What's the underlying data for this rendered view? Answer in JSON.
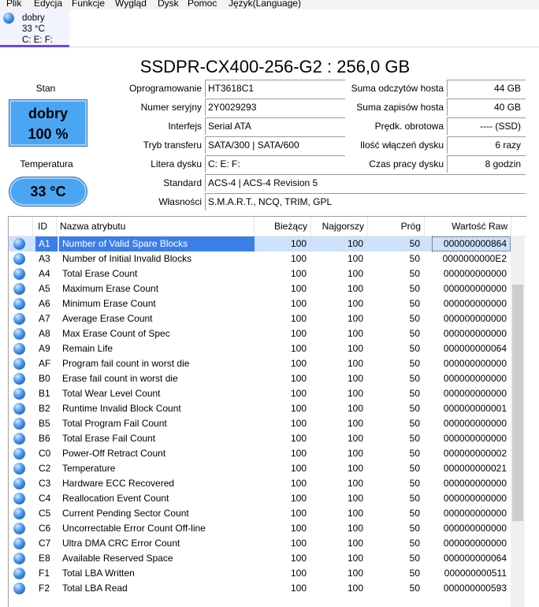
{
  "menu": [
    "Plik",
    "Edycja",
    "Funkcje",
    "Wygląd",
    "Dysk",
    "Pomoc",
    "Język(Language)"
  ],
  "disk_tab": {
    "status": "dobry",
    "temp": "33 °C",
    "letters": "C: E: F:"
  },
  "title": "SSDPR-CX400-256-G2 : 256,0 GB",
  "status": {
    "health_caption": "Stan",
    "health_label": "dobry",
    "health_percent": "100 %",
    "temp_caption": "Temperatura",
    "temp_value": "33 °C"
  },
  "info_left": [
    {
      "label": "Oprogramowanie",
      "value": "HT3618C1"
    },
    {
      "label": "Numer seryjny",
      "value": "2Y0029293"
    },
    {
      "label": "Interfejs",
      "value": "Serial ATA"
    },
    {
      "label": "Tryb transferu",
      "value": "SATA/300 | SATA/600"
    },
    {
      "label": "Litera dysku",
      "value": "C: E: F:"
    }
  ],
  "info_right": [
    {
      "label": "Suma odczytów hosta",
      "value": "44 GB"
    },
    {
      "label": "Suma zapisów hosta",
      "value": "40 GB"
    },
    {
      "label": "Prędk. obrotowa",
      "value": "---- (SSD)"
    },
    {
      "label": "Ilość włączeń dysku",
      "value": "6 razy"
    },
    {
      "label": "Czas pracy dysku",
      "value": "8 godzin"
    }
  ],
  "info_wide": [
    {
      "label": "Standard",
      "value": "ACS-4 | ACS-4 Revision 5"
    },
    {
      "label": "Własności",
      "value": "S.M.A.R.T., NCQ, TRIM, GPL"
    }
  ],
  "table": {
    "columns": [
      "ID",
      "Nazwa atrybutu",
      "Bieżący",
      "Najgorszy",
      "Próg",
      "Wartość Raw"
    ],
    "rows": [
      [
        "A1",
        "Number of Valid Spare Blocks",
        "100",
        "100",
        "50",
        "000000000864"
      ],
      [
        "A3",
        "Number of Initial Invalid Blocks",
        "100",
        "100",
        "50",
        "0000000000E2"
      ],
      [
        "A4",
        "Total Erase Count",
        "100",
        "100",
        "50",
        "000000000000"
      ],
      [
        "A5",
        "Maximum Erase Count",
        "100",
        "100",
        "50",
        "000000000000"
      ],
      [
        "A6",
        "Minimum Erase Count",
        "100",
        "100",
        "50",
        "000000000000"
      ],
      [
        "A7",
        "Average Erase Count",
        "100",
        "100",
        "50",
        "000000000000"
      ],
      [
        "A8",
        "Max Erase Count of Spec",
        "100",
        "100",
        "50",
        "000000000000"
      ],
      [
        "A9",
        "Remain Life",
        "100",
        "100",
        "50",
        "000000000064"
      ],
      [
        "AF",
        "Program fail count in worst die",
        "100",
        "100",
        "50",
        "000000000000"
      ],
      [
        "B0",
        "Erase fail count in worst die",
        "100",
        "100",
        "50",
        "000000000000"
      ],
      [
        "B1",
        "Total Wear Level Count",
        "100",
        "100",
        "50",
        "000000000000"
      ],
      [
        "B2",
        "Runtime Invalid Block Count",
        "100",
        "100",
        "50",
        "000000000001"
      ],
      [
        "B5",
        "Total Program Fail Count",
        "100",
        "100",
        "50",
        "000000000000"
      ],
      [
        "B6",
        "Total Erase Fail Count",
        "100",
        "100",
        "50",
        "000000000000"
      ],
      [
        "C0",
        "Power-Off Retract Count",
        "100",
        "100",
        "50",
        "000000000002"
      ],
      [
        "C2",
        "Temperature",
        "100",
        "100",
        "50",
        "000000000021"
      ],
      [
        "C3",
        "Hardware ECC Recovered",
        "100",
        "100",
        "50",
        "000000000000"
      ],
      [
        "C4",
        "Reallocation Event Count",
        "100",
        "100",
        "50",
        "000000000000"
      ],
      [
        "C5",
        "Current Pending Sector Count",
        "100",
        "100",
        "50",
        "000000000000"
      ],
      [
        "C6",
        "Uncorrectable Error Count Off-line",
        "100",
        "100",
        "50",
        "000000000000"
      ],
      [
        "C7",
        "Ultra DMA CRC Error Count",
        "100",
        "100",
        "50",
        "000000000000"
      ],
      [
        "E8",
        "Available Reserved Space",
        "100",
        "100",
        "50",
        "000000000064"
      ],
      [
        "F1",
        "Total LBA Written",
        "100",
        "100",
        "50",
        "000000000511"
      ],
      [
        "F2",
        "Total LBA Read",
        "100",
        "100",
        "50",
        "000000000593"
      ]
    ],
    "selected_row": 0
  },
  "colors": {
    "status_blue": "#4aa6f2",
    "selection": "#3b7ee8",
    "tab_underline": "#6b4ec7"
  },
  "icons": {
    "status_dot": "blue-circle-icon"
  }
}
